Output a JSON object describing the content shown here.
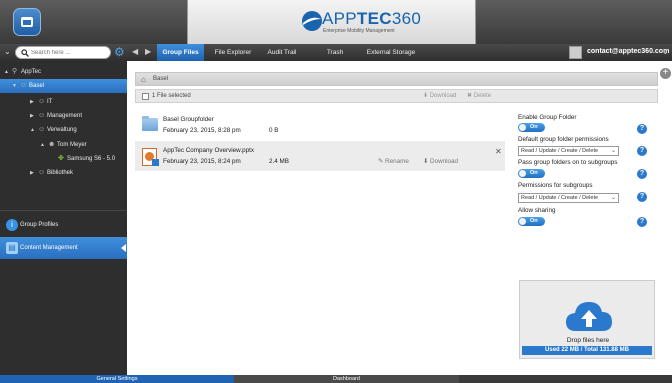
{
  "header": {
    "logo_app": "APP",
    "logo_tec": "TEC",
    "logo_num": "360",
    "logo_tagline": "Enterprise Mobility Management"
  },
  "navbar": {
    "search_placeholder": "Search here ...",
    "tabs": [
      {
        "label": "Group Files",
        "active": true
      },
      {
        "label": "File Explorer",
        "active": false
      },
      {
        "label": "Audit Trail",
        "active": false
      },
      {
        "label": "Trash",
        "active": false
      },
      {
        "label": "External Storage",
        "active": false
      }
    ],
    "user_email": "contact@apptec360.com"
  },
  "sidebar": {
    "tree": [
      {
        "label": "AppTec",
        "expand": "▲",
        "icon": "⚲"
      },
      {
        "label": "Basel",
        "expand": "▼",
        "icon": "☺",
        "selected": true
      },
      {
        "label": "IT",
        "expand": "▶",
        "icon": "☺"
      },
      {
        "label": "Management",
        "expand": "▶",
        "icon": "☺"
      },
      {
        "label": "Verwaltung",
        "expand": "▲",
        "icon": "☺"
      },
      {
        "label": "Tom Meyer",
        "expand": "▲",
        "icon": "☻"
      },
      {
        "label": "Samsung S6 - 5.0",
        "expand": "",
        "icon": "✤"
      },
      {
        "label": "Bibliothek",
        "expand": "▶",
        "icon": "☺"
      }
    ],
    "bottom": [
      {
        "label": "Group Profiles",
        "icon": "i"
      },
      {
        "label": "Content Management",
        "icon": "▤"
      }
    ]
  },
  "main": {
    "breadcrumb": "Basel",
    "selection_label": "1 File selected",
    "toolbar_download": "Download",
    "toolbar_delete": "Delete",
    "files": [
      {
        "name": "Basel Groupfolder",
        "date": "February 23, 2015, 8:28 pm",
        "size": "0 B",
        "type": "folder"
      },
      {
        "name": "AppTec Company Overview.pptx",
        "date": "February 23, 2015, 8:24 pm",
        "size": "2.4 MB",
        "type": "pptx",
        "rename": "Rename",
        "download": "Download"
      }
    ]
  },
  "settings": {
    "enable_group_folder": "Enable Group Folder",
    "toggle_on": "On",
    "default_permissions": "Default group folder permissions",
    "permission_value": "Read / Update / Create / Delete",
    "pass_to_subgroups": "Pass group folders on to subgroups",
    "permissions_subgroups": "Permissions for subgroups",
    "allow_sharing": "Allow sharing",
    "help": "?"
  },
  "dropzone": {
    "text": "Drop files here",
    "usage": "Used 22 MB / Total 131.88 MB"
  },
  "bottombar": {
    "left": "General Settings",
    "right": "Dashboard"
  },
  "colors": {
    "accent": "#2a79cc",
    "sidebar_bg": "#2e2e2e",
    "header_bg": "#4a4a4a"
  }
}
